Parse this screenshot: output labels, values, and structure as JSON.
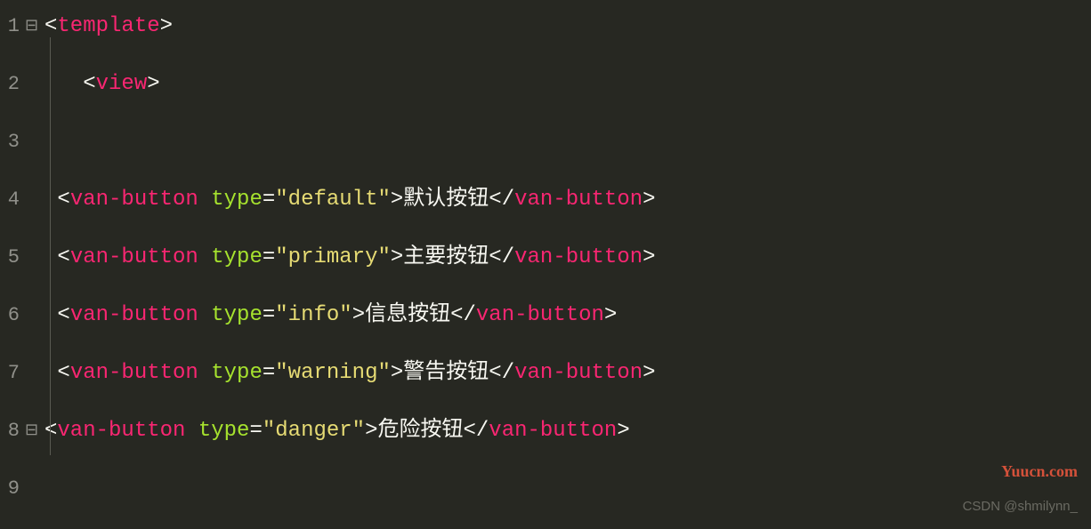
{
  "lines": [
    {
      "num": "1",
      "fold": "⊟",
      "indent": "",
      "parts": [
        {
          "t": "bracket",
          "v": "<"
        },
        {
          "t": "tag-name",
          "v": "template"
        },
        {
          "t": "bracket",
          "v": ">"
        }
      ]
    },
    {
      "num": "2",
      "fold": "",
      "indent": "   ",
      "parts": [
        {
          "t": "bracket",
          "v": "<"
        },
        {
          "t": "tag-name",
          "v": "view"
        },
        {
          "t": "bracket",
          "v": ">"
        }
      ]
    },
    {
      "num": "3",
      "fold": "",
      "indent": "",
      "parts": []
    },
    {
      "num": "4",
      "fold": "",
      "indent": " ",
      "parts": [
        {
          "t": "bracket",
          "v": "<"
        },
        {
          "t": "tag-name",
          "v": "van-button"
        },
        {
          "t": "bracket",
          "v": " "
        },
        {
          "t": "attr-name",
          "v": "type"
        },
        {
          "t": "attr-eq",
          "v": "="
        },
        {
          "t": "string",
          "v": "\"default\""
        },
        {
          "t": "bracket",
          "v": ">"
        },
        {
          "t": "text-content",
          "v": "默认按钮"
        },
        {
          "t": "bracket",
          "v": "</"
        },
        {
          "t": "tag-name",
          "v": "van-button"
        },
        {
          "t": "bracket",
          "v": ">"
        }
      ]
    },
    {
      "num": "5",
      "fold": "",
      "indent": " ",
      "parts": [
        {
          "t": "bracket",
          "v": "<"
        },
        {
          "t": "tag-name",
          "v": "van-button"
        },
        {
          "t": "bracket",
          "v": " "
        },
        {
          "t": "attr-name",
          "v": "type"
        },
        {
          "t": "attr-eq",
          "v": "="
        },
        {
          "t": "string",
          "v": "\"primary\""
        },
        {
          "t": "bracket",
          "v": ">"
        },
        {
          "t": "text-content",
          "v": "主要按钮"
        },
        {
          "t": "bracket",
          "v": "</"
        },
        {
          "t": "tag-name",
          "v": "van-button"
        },
        {
          "t": "bracket",
          "v": ">"
        }
      ]
    },
    {
      "num": "6",
      "fold": "",
      "indent": " ",
      "parts": [
        {
          "t": "bracket",
          "v": "<"
        },
        {
          "t": "tag-name",
          "v": "van-button"
        },
        {
          "t": "bracket",
          "v": " "
        },
        {
          "t": "attr-name",
          "v": "type"
        },
        {
          "t": "attr-eq",
          "v": "="
        },
        {
          "t": "string",
          "v": "\"info\""
        },
        {
          "t": "bracket",
          "v": ">"
        },
        {
          "t": "text-content",
          "v": "信息按钮"
        },
        {
          "t": "bracket",
          "v": "</"
        },
        {
          "t": "tag-name",
          "v": "van-button"
        },
        {
          "t": "bracket",
          "v": ">"
        }
      ]
    },
    {
      "num": "7",
      "fold": "",
      "indent": " ",
      "parts": [
        {
          "t": "bracket",
          "v": "<"
        },
        {
          "t": "tag-name",
          "v": "van-button"
        },
        {
          "t": "bracket",
          "v": " "
        },
        {
          "t": "attr-name",
          "v": "type"
        },
        {
          "t": "attr-eq",
          "v": "="
        },
        {
          "t": "string",
          "v": "\"warning\""
        },
        {
          "t": "bracket",
          "v": ">"
        },
        {
          "t": "text-content",
          "v": "警告按钮"
        },
        {
          "t": "bracket",
          "v": "</"
        },
        {
          "t": "tag-name",
          "v": "van-button"
        },
        {
          "t": "bracket",
          "v": ">"
        }
      ]
    },
    {
      "num": "8",
      "fold": "⊟",
      "indent": "",
      "parts": [
        {
          "t": "bracket",
          "v": "<"
        },
        {
          "t": "tag-name",
          "v": "van-button"
        },
        {
          "t": "bracket",
          "v": " "
        },
        {
          "t": "attr-name",
          "v": "type"
        },
        {
          "t": "attr-eq",
          "v": "="
        },
        {
          "t": "string",
          "v": "\"danger\""
        },
        {
          "t": "bracket",
          "v": ">"
        },
        {
          "t": "text-content",
          "v": "危险按钮"
        },
        {
          "t": "bracket",
          "v": "</"
        },
        {
          "t": "tag-name",
          "v": "van-button"
        },
        {
          "t": "bracket",
          "v": ">"
        }
      ]
    },
    {
      "num": "9",
      "fold": "",
      "indent": "",
      "parts": []
    }
  ],
  "watermarks": {
    "right": "Yuucn.com",
    "bottom": "CSDN @shmilynn_"
  }
}
